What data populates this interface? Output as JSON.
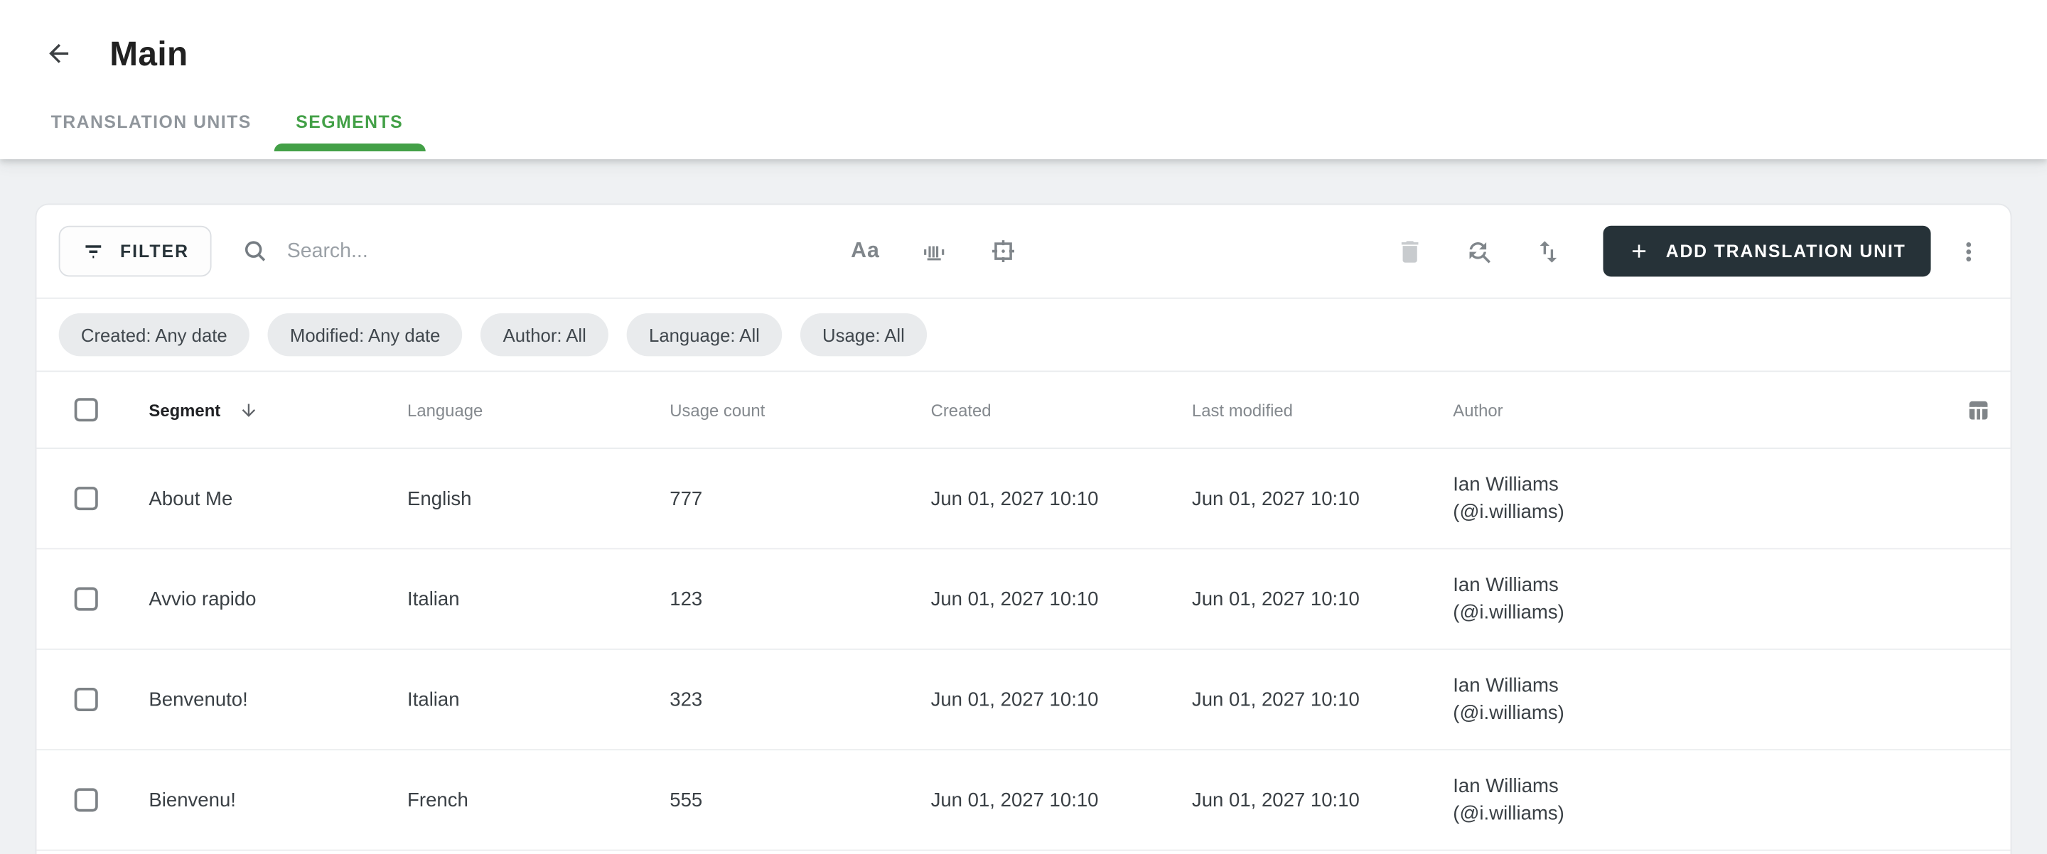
{
  "page": {
    "title": "Main"
  },
  "tabs": [
    {
      "label": "TRANSLATION UNITS",
      "active": false
    },
    {
      "label": "SEGMENTS",
      "active": true
    }
  ],
  "toolbar": {
    "filter_label": "FILTER",
    "search_placeholder": "Search...",
    "search_value": "",
    "match_case_label": "Aa",
    "add_button_label": "ADD TRANSLATION UNIT",
    "icons": [
      "filter-icon",
      "search-icon",
      "match-case-icon",
      "match-whole-word-icon",
      "match-regex-icon",
      "delete-icon",
      "find-replace-icon",
      "sort-icon",
      "plus-icon",
      "more-vert-icon"
    ]
  },
  "filter_chips": [
    {
      "label": "Created: Any date"
    },
    {
      "label": "Modified: Any date"
    },
    {
      "label": "Author: All"
    },
    {
      "label": "Language: All"
    },
    {
      "label": "Usage: All"
    }
  ],
  "table": {
    "sort": {
      "column": "Segment",
      "direction": "descending"
    },
    "columns": [
      {
        "label": "Segment"
      },
      {
        "label": "Language"
      },
      {
        "label": "Usage count"
      },
      {
        "label": "Created"
      },
      {
        "label": "Last modified"
      },
      {
        "label": "Author"
      }
    ],
    "rows": [
      {
        "segment": "About Me",
        "language": "English",
        "usage_count": "777",
        "created": "Jun 01, 2027 10:10",
        "last_modified": "Jun 01, 2027 10:10",
        "author_name": "Ian Williams",
        "author_handle": "(@i.williams)",
        "selected": false
      },
      {
        "segment": "Avvio rapido",
        "language": "Italian",
        "usage_count": "123",
        "created": "Jun 01, 2027 10:10",
        "last_modified": "Jun 01, 2027 10:10",
        "author_name": "Ian Williams",
        "author_handle": "(@i.williams)",
        "selected": false
      },
      {
        "segment": "Benvenuto!",
        "language": "Italian",
        "usage_count": "323",
        "created": "Jun 01, 2027 10:10",
        "last_modified": "Jun 01, 2027 10:10",
        "author_name": "Ian Williams",
        "author_handle": "(@i.williams)",
        "selected": false
      },
      {
        "segment": "Bienvenu!",
        "language": "French",
        "usage_count": "555",
        "created": "Jun 01, 2027 10:10",
        "last_modified": "Jun 01, 2027 10:10",
        "author_name": "Ian Williams",
        "author_handle": "(@i.williams)",
        "selected": false
      }
    ]
  },
  "colors": {
    "accent_green": "#43a047",
    "primary_button_bg": "#263238",
    "page_background": "#eff1f3",
    "chip_background": "#e9ebed"
  }
}
